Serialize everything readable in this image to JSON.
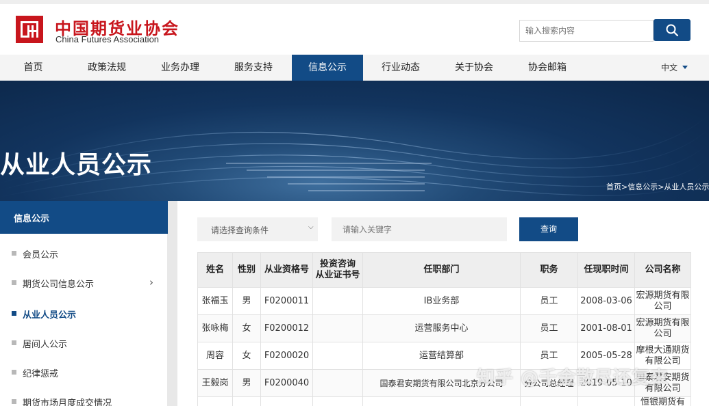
{
  "brand": {
    "name_cn": "中国期货业协会",
    "name_en": "China Futures Association",
    "logo_color": "#c8161d"
  },
  "search": {
    "placeholder": "输入搜索内容",
    "icon": "search-icon"
  },
  "nav": {
    "items": [
      "首页",
      "政策法规",
      "业务办理",
      "服务支持",
      "信息公示",
      "行业动态",
      "关于协会",
      "协会邮箱"
    ],
    "active": "信息公示",
    "language": "中文",
    "accent": "#124b86"
  },
  "banner": {
    "title": "从业人员公示",
    "breadcrumb": "首页>信息公示>从业人员公示"
  },
  "sidebar": {
    "header": "信息公示",
    "items": [
      {
        "label": "会员公示"
      },
      {
        "label": "期货公司信息公示"
      },
      {
        "label": "从业人员公示"
      },
      {
        "label": "居间人公示"
      },
      {
        "label": "纪律惩戒"
      },
      {
        "label": "期货市场月度成交情况"
      }
    ],
    "active": "从业人员公示"
  },
  "filter": {
    "select_placeholder": "请选择查询条件",
    "keyword_placeholder": "请输入关键字",
    "query_label": "查询"
  },
  "table": {
    "headers": {
      "name": "姓名",
      "gender": "性别",
      "qual_no": "从业资格号",
      "invest_cert_1": "投资咨询",
      "invest_cert_2": "从业证书号",
      "department": "任职部门",
      "position": "职务",
      "start_date": "任现职时间",
      "company": "公司名称"
    },
    "rows": [
      {
        "name": "张福玉",
        "gender": "男",
        "qual_no": "F0200011",
        "cert": "",
        "department": "IB业务部",
        "position": "员工",
        "start_date": "2008-03-06",
        "company_1": "宏源期货有限",
        "company_2": "公司"
      },
      {
        "name": "张咏梅",
        "gender": "女",
        "qual_no": "F0200012",
        "cert": "",
        "department": "运营服务中心",
        "position": "员工",
        "start_date": "2001-08-01",
        "company_1": "宏源期货有限",
        "company_2": "公司"
      },
      {
        "name": "周容",
        "gender": "女",
        "qual_no": "F0200020",
        "cert": "",
        "department": "运营结算部",
        "position": "员工",
        "start_date": "2005-05-28",
        "company_1": "摩根大通期货",
        "company_2": "有限公司"
      },
      {
        "name": "王毅岗",
        "gender": "男",
        "qual_no": "F0200040",
        "cert": "",
        "department": "国泰君安期货有限公司北京分公司",
        "position": "分公司总经理",
        "start_date": "2019-05-10",
        "company_1": "国泰君安期货",
        "company_2": "有限公司"
      },
      {
        "name": "",
        "gender": "",
        "qual_no": "",
        "cert": "",
        "department": "",
        "position": "",
        "start_date": "",
        "company_1": "恒银期货有",
        "company_2": ""
      }
    ]
  },
  "watermark": "知乎 @千金散尽还复来"
}
